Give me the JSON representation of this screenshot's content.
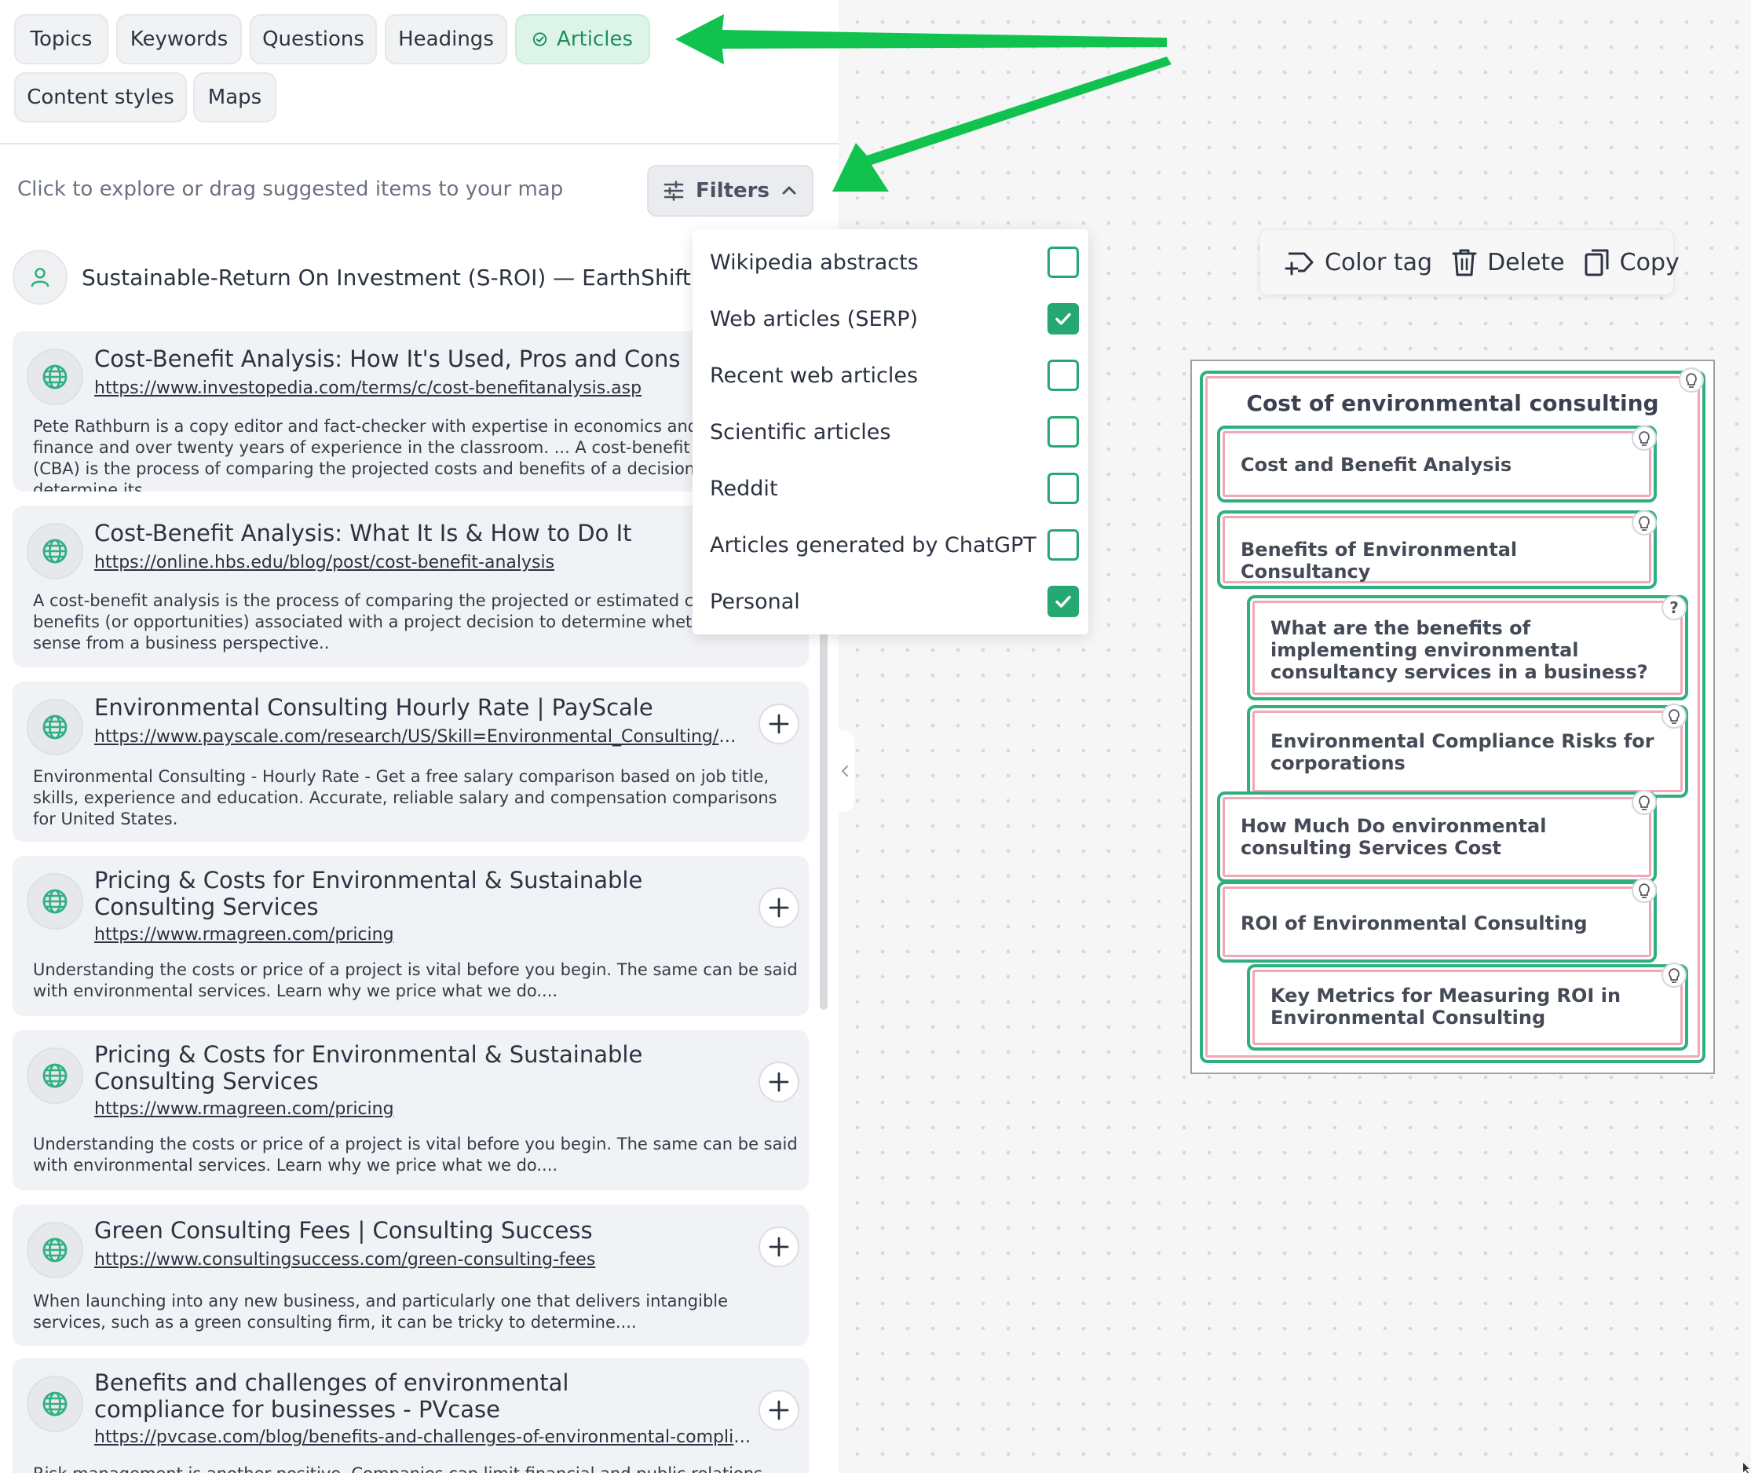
{
  "tabs": [
    {
      "label": "Topics",
      "active": false
    },
    {
      "label": "Keywords",
      "active": false
    },
    {
      "label": "Questions",
      "active": false
    },
    {
      "label": "Headings",
      "active": false
    },
    {
      "label": "Articles",
      "active": true
    },
    {
      "label": "Content styles",
      "active": false
    },
    {
      "label": "Maps",
      "active": false
    }
  ],
  "hint": "Click to explore or drag suggested items to your map",
  "filters_label": "Filters",
  "author": "Sustainable-Return On Investment (S-ROI) — EarthShift Global",
  "articles": [
    {
      "title": "Cost-Benefit Analysis: How It's Used, Pros and Cons",
      "url": "https://www.investopedia.com/terms/c/cost-benefitanalysis.asp",
      "desc": "Pete Rathburn is a copy editor and fact-checker with expertise in economics and personal finance and over twenty years of experience in the classroom. ... A cost-benefit analysis (CBA) is the process of comparing the projected costs and benefits of a decision to determine its..."
    },
    {
      "title": "Cost-Benefit Analysis: What It Is & How to Do It",
      "url": "https://online.hbs.edu/blog/post/cost-benefit-analysis",
      "desc": "A cost-benefit analysis is the process of comparing the projected or estimated costs and benefits (or opportunities) associated with a project decision to determine whether it makes sense from a business perspective.."
    },
    {
      "title": "Environmental Consulting Hourly Rate | PayScale",
      "url": "https://www.payscale.com/research/US/Skill=Environmental_Consulting/Hourly_Rate",
      "desc": "Environmental Consulting - Hourly Rate - Get a free salary comparison based on job title, skills, experience and education. Accurate, reliable salary and compensation comparisons for United States."
    },
    {
      "title": "Pricing & Costs for Environmental & Sustainable Consulting Services",
      "url": "https://www.rmagreen.com/pricing",
      "desc": "Understanding the costs or price of a project is vital before you begin. The same can be said with environmental services. Learn why we price what we do...."
    },
    {
      "title": "Pricing & Costs for Environmental & Sustainable Consulting Services",
      "url": "https://www.rmagreen.com/pricing",
      "desc": "Understanding the costs or price of a project is vital before you begin. The same can be said with environmental services. Learn why we price what we do...."
    },
    {
      "title": "Green Consulting Fees | Consulting Success",
      "url": "https://www.consultingsuccess.com/green-consulting-fees",
      "desc": "When launching into any new business, and particularly one that delivers intangible services, such as a green consulting firm, it can be tricky to determine...."
    },
    {
      "title": "Benefits and challenges of environmental compliance for businesses - PVcase",
      "url": "https://pvcase.com/blog/benefits-and-challenges-of-environmental-compliance-for-businesses",
      "desc": "Risk management is another positive. Companies can limit financial and public relations damage..."
    }
  ],
  "filters": [
    {
      "label": "Wikipedia abstracts",
      "checked": false
    },
    {
      "label": "Web articles (SERP)",
      "checked": true
    },
    {
      "label": "Recent web articles",
      "checked": false
    },
    {
      "label": "Scientific articles",
      "checked": false
    },
    {
      "label": "Reddit",
      "checked": false
    },
    {
      "label": "Articles generated by ChatGPT",
      "checked": false
    },
    {
      "label": "Personal",
      "checked": true
    }
  ],
  "toolbar": {
    "color_tag": "Color tag",
    "delete": "Delete",
    "copy": "Copy"
  },
  "map": {
    "root": "Cost of environmental consulting",
    "nodes": [
      {
        "text": "Cost and Benefit Analysis",
        "marker": "bulb"
      },
      {
        "text": "Benefits of Environmental Consultancy",
        "marker": "bulb"
      },
      {
        "text": "What are the benefits of implementing environmental consultancy services in a business?",
        "marker": "question"
      },
      {
        "text": "Environmental Compliance Risks for corporations",
        "marker": "bulb"
      },
      {
        "text": "How Much Do environmental consulting Services Cost",
        "marker": "bulb"
      },
      {
        "text": "ROI of Environmental Consulting",
        "marker": "bulb"
      },
      {
        "text": "Key Metrics for Measuring ROI in Environmental Consulting",
        "marker": "bulb"
      }
    ]
  },
  "colors": {
    "accent": "#27a772",
    "node_border": "#2fb081",
    "node_inner": "#f0a9b4",
    "arrow": "#12c24f"
  }
}
